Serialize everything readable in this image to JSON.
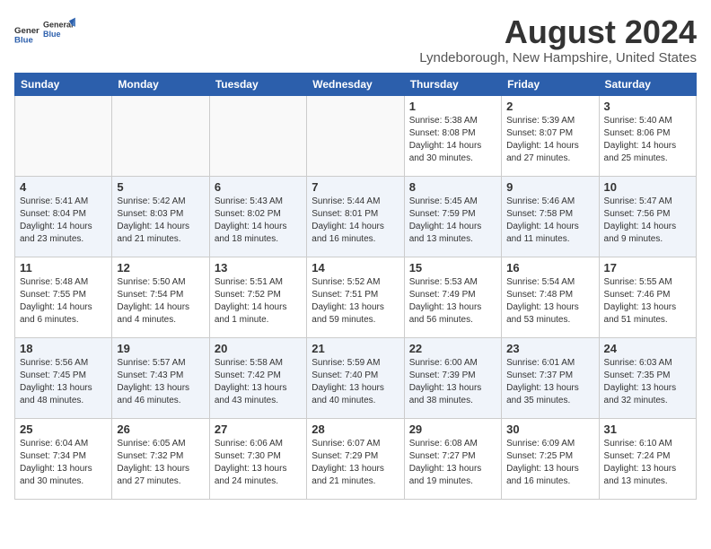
{
  "header": {
    "logo_general": "General",
    "logo_blue": "Blue",
    "month_year": "August 2024",
    "location": "Lyndeborough, New Hampshire, United States"
  },
  "weekdays": [
    "Sunday",
    "Monday",
    "Tuesday",
    "Wednesday",
    "Thursday",
    "Friday",
    "Saturday"
  ],
  "weeks": [
    [
      {
        "day": "",
        "empty": true
      },
      {
        "day": "",
        "empty": true
      },
      {
        "day": "",
        "empty": true
      },
      {
        "day": "",
        "empty": true
      },
      {
        "day": "1",
        "sunrise": "5:38 AM",
        "sunset": "8:08 PM",
        "daylight": "14 hours and 30 minutes."
      },
      {
        "day": "2",
        "sunrise": "5:39 AM",
        "sunset": "8:07 PM",
        "daylight": "14 hours and 27 minutes."
      },
      {
        "day": "3",
        "sunrise": "5:40 AM",
        "sunset": "8:06 PM",
        "daylight": "14 hours and 25 minutes."
      }
    ],
    [
      {
        "day": "4",
        "sunrise": "5:41 AM",
        "sunset": "8:04 PM",
        "daylight": "14 hours and 23 minutes."
      },
      {
        "day": "5",
        "sunrise": "5:42 AM",
        "sunset": "8:03 PM",
        "daylight": "14 hours and 21 minutes."
      },
      {
        "day": "6",
        "sunrise": "5:43 AM",
        "sunset": "8:02 PM",
        "daylight": "14 hours and 18 minutes."
      },
      {
        "day": "7",
        "sunrise": "5:44 AM",
        "sunset": "8:01 PM",
        "daylight": "14 hours and 16 minutes."
      },
      {
        "day": "8",
        "sunrise": "5:45 AM",
        "sunset": "7:59 PM",
        "daylight": "14 hours and 13 minutes."
      },
      {
        "day": "9",
        "sunrise": "5:46 AM",
        "sunset": "7:58 PM",
        "daylight": "14 hours and 11 minutes."
      },
      {
        "day": "10",
        "sunrise": "5:47 AM",
        "sunset": "7:56 PM",
        "daylight": "14 hours and 9 minutes."
      }
    ],
    [
      {
        "day": "11",
        "sunrise": "5:48 AM",
        "sunset": "7:55 PM",
        "daylight": "14 hours and 6 minutes."
      },
      {
        "day": "12",
        "sunrise": "5:50 AM",
        "sunset": "7:54 PM",
        "daylight": "14 hours and 4 minutes."
      },
      {
        "day": "13",
        "sunrise": "5:51 AM",
        "sunset": "7:52 PM",
        "daylight": "14 hours and 1 minute."
      },
      {
        "day": "14",
        "sunrise": "5:52 AM",
        "sunset": "7:51 PM",
        "daylight": "13 hours and 59 minutes."
      },
      {
        "day": "15",
        "sunrise": "5:53 AM",
        "sunset": "7:49 PM",
        "daylight": "13 hours and 56 minutes."
      },
      {
        "day": "16",
        "sunrise": "5:54 AM",
        "sunset": "7:48 PM",
        "daylight": "13 hours and 53 minutes."
      },
      {
        "day": "17",
        "sunrise": "5:55 AM",
        "sunset": "7:46 PM",
        "daylight": "13 hours and 51 minutes."
      }
    ],
    [
      {
        "day": "18",
        "sunrise": "5:56 AM",
        "sunset": "7:45 PM",
        "daylight": "13 hours and 48 minutes."
      },
      {
        "day": "19",
        "sunrise": "5:57 AM",
        "sunset": "7:43 PM",
        "daylight": "13 hours and 46 minutes."
      },
      {
        "day": "20",
        "sunrise": "5:58 AM",
        "sunset": "7:42 PM",
        "daylight": "13 hours and 43 minutes."
      },
      {
        "day": "21",
        "sunrise": "5:59 AM",
        "sunset": "7:40 PM",
        "daylight": "13 hours and 40 minutes."
      },
      {
        "day": "22",
        "sunrise": "6:00 AM",
        "sunset": "7:39 PM",
        "daylight": "13 hours and 38 minutes."
      },
      {
        "day": "23",
        "sunrise": "6:01 AM",
        "sunset": "7:37 PM",
        "daylight": "13 hours and 35 minutes."
      },
      {
        "day": "24",
        "sunrise": "6:03 AM",
        "sunset": "7:35 PM",
        "daylight": "13 hours and 32 minutes."
      }
    ],
    [
      {
        "day": "25",
        "sunrise": "6:04 AM",
        "sunset": "7:34 PM",
        "daylight": "13 hours and 30 minutes."
      },
      {
        "day": "26",
        "sunrise": "6:05 AM",
        "sunset": "7:32 PM",
        "daylight": "13 hours and 27 minutes."
      },
      {
        "day": "27",
        "sunrise": "6:06 AM",
        "sunset": "7:30 PM",
        "daylight": "13 hours and 24 minutes."
      },
      {
        "day": "28",
        "sunrise": "6:07 AM",
        "sunset": "7:29 PM",
        "daylight": "13 hours and 21 minutes."
      },
      {
        "day": "29",
        "sunrise": "6:08 AM",
        "sunset": "7:27 PM",
        "daylight": "13 hours and 19 minutes."
      },
      {
        "day": "30",
        "sunrise": "6:09 AM",
        "sunset": "7:25 PM",
        "daylight": "13 hours and 16 minutes."
      },
      {
        "day": "31",
        "sunrise": "6:10 AM",
        "sunset": "7:24 PM",
        "daylight": "13 hours and 13 minutes."
      }
    ]
  ]
}
